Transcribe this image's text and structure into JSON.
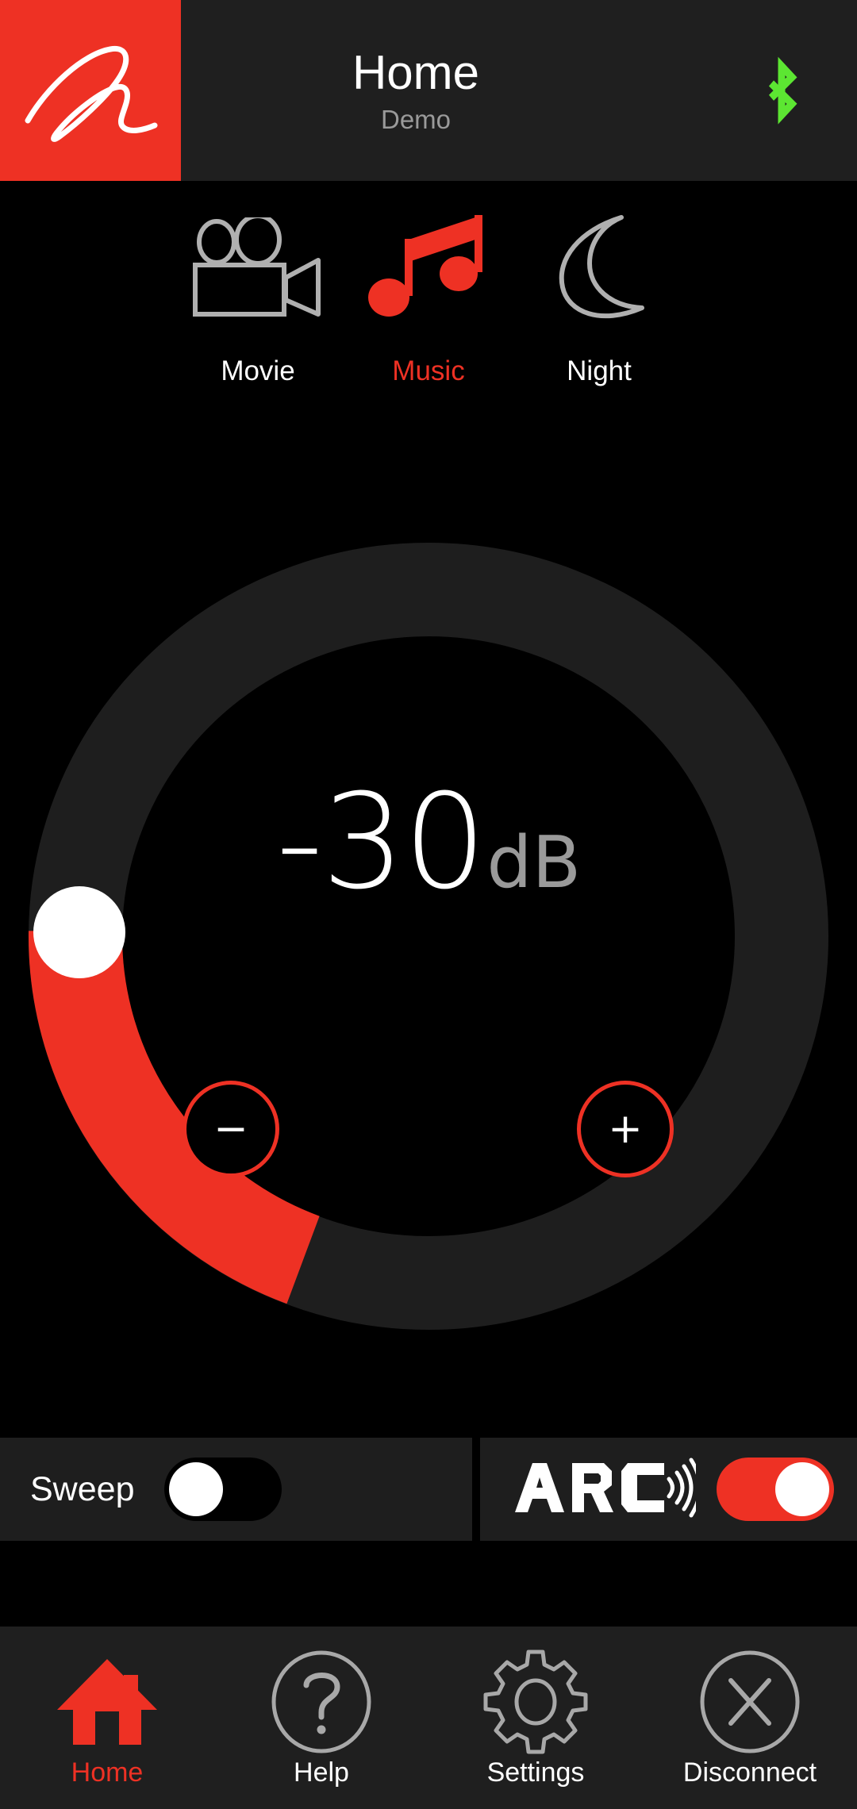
{
  "header": {
    "logo_icon": "martinlogan-script-logo",
    "title": "Home",
    "subtitle": "Demo",
    "bluetooth_icon": "bluetooth-icon",
    "bluetooth_color": "#5ce632",
    "background": "#1f1f1f",
    "logo_tile_color": "#ee3124"
  },
  "modes": {
    "items": [
      {
        "id": "movie",
        "label": "Movie",
        "icon": "movie-camera-icon",
        "active": false,
        "color": "#b0b0b0"
      },
      {
        "id": "music",
        "label": "Music",
        "icon": "music-note-icon",
        "active": true,
        "color": "#ee3124"
      },
      {
        "id": "night",
        "label": "Night",
        "icon": "moon-icon",
        "active": false,
        "color": "#b0b0b0"
      }
    ]
  },
  "volume": {
    "value": "-30",
    "unit": "dB",
    "track_color": "#1e1e1e",
    "fill_color": "#ee3124",
    "knob_color": "#ffffff",
    "minus_label": "−",
    "plus_label": "+",
    "minus_icon": "minus-icon",
    "plus_icon": "plus-icon"
  },
  "toggles": {
    "sweep": {
      "label": "Sweep",
      "state": "off",
      "track_color": "#000000",
      "knob_color": "#ffffff"
    },
    "arc": {
      "label": "ARC",
      "logo_icon": "arc-waves-logo",
      "state": "on",
      "track_color": "#ee3124",
      "knob_color": "#ffffff"
    }
  },
  "bottom_nav": {
    "items": [
      {
        "id": "home",
        "label": "Home",
        "icon": "house-icon",
        "active": true,
        "color": "#ee3124"
      },
      {
        "id": "help",
        "label": "Help",
        "icon": "question-circle-icon",
        "active": false,
        "color": "#a8a8a8"
      },
      {
        "id": "settings",
        "label": "Settings",
        "icon": "gear-icon",
        "active": false,
        "color": "#a8a8a8"
      },
      {
        "id": "disconnect",
        "label": "Disconnect",
        "icon": "close-circle-icon",
        "active": false,
        "color": "#a8a8a8"
      }
    ],
    "background": "#1f1f1f"
  }
}
